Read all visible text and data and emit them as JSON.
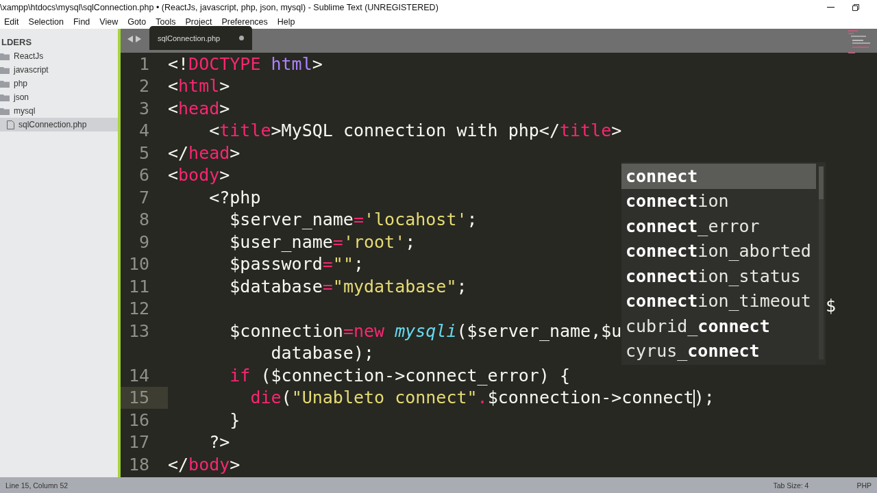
{
  "window": {
    "title": "\\xampp\\htdocs\\mysql\\sqlConnection.php • (ReactJs, javascript, php, json, mysql) - Sublime Text (UNREGISTERED)"
  },
  "menu": [
    "Edit",
    "Selection",
    "Find",
    "View",
    "Goto",
    "Tools",
    "Project",
    "Preferences",
    "Help"
  ],
  "sidebar": {
    "header": "LDERS",
    "items": [
      {
        "label": "ReactJs",
        "kind": "folder",
        "selected": false
      },
      {
        "label": "javascript",
        "kind": "folder",
        "selected": false
      },
      {
        "label": "php",
        "kind": "folder",
        "selected": false
      },
      {
        "label": "json",
        "kind": "folder",
        "selected": false
      },
      {
        "label": "mysql",
        "kind": "folder",
        "selected": false
      },
      {
        "label": "sqlConnection.php",
        "kind": "file",
        "selected": true
      }
    ]
  },
  "tabs": [
    {
      "label": "sqlConnection.php",
      "selected": true,
      "modified": true
    }
  ],
  "editor": {
    "lines": [
      {
        "number": "1",
        "current": false,
        "segments": [
          {
            "kind": "plain",
            "text": "<!"
          },
          {
            "kind": "tag",
            "text": "DOCTYPE"
          },
          {
            "kind": "purple",
            "text": " html"
          },
          {
            "kind": "plain",
            "text": ">"
          }
        ]
      },
      {
        "number": "2",
        "current": false,
        "segments": [
          {
            "kind": "plain",
            "text": "<"
          },
          {
            "kind": "tag",
            "text": "html"
          },
          {
            "kind": "plain",
            "text": ">"
          }
        ]
      },
      {
        "number": "3",
        "current": false,
        "segments": [
          {
            "kind": "plain",
            "text": "<"
          },
          {
            "kind": "tag",
            "text": "head"
          },
          {
            "kind": "plain",
            "text": ">"
          }
        ]
      },
      {
        "number": "4",
        "current": false,
        "segments": [
          {
            "kind": "plain",
            "text": "    <"
          },
          {
            "kind": "tag",
            "text": "title"
          },
          {
            "kind": "plain",
            "text": ">MySQL connection with php</"
          },
          {
            "kind": "tag",
            "text": "title"
          },
          {
            "kind": "plain",
            "text": ">"
          }
        ]
      },
      {
        "number": "5",
        "current": false,
        "segments": [
          {
            "kind": "plain",
            "text": "</"
          },
          {
            "kind": "tag",
            "text": "head"
          },
          {
            "kind": "plain",
            "text": ">"
          }
        ]
      },
      {
        "number": "6",
        "current": false,
        "segments": [
          {
            "kind": "plain",
            "text": "<"
          },
          {
            "kind": "tag",
            "text": "body"
          },
          {
            "kind": "plain",
            "text": ">"
          }
        ]
      },
      {
        "number": "7",
        "current": false,
        "segments": [
          {
            "kind": "plain",
            "text": "    <?php"
          }
        ]
      },
      {
        "number": "8",
        "current": false,
        "segments": [
          {
            "kind": "plain",
            "text": "      $server_name"
          },
          {
            "kind": "tag",
            "text": "="
          },
          {
            "kind": "string",
            "text": "'locahost'"
          },
          {
            "kind": "plain",
            "text": ";"
          }
        ]
      },
      {
        "number": "9",
        "current": false,
        "segments": [
          {
            "kind": "plain",
            "text": "      $user_name"
          },
          {
            "kind": "tag",
            "text": "="
          },
          {
            "kind": "string",
            "text": "'root'"
          },
          {
            "kind": "plain",
            "text": ";"
          }
        ]
      },
      {
        "number": "10",
        "current": false,
        "segments": [
          {
            "kind": "plain",
            "text": "      $password"
          },
          {
            "kind": "tag",
            "text": "="
          },
          {
            "kind": "string",
            "text": "\"\""
          },
          {
            "kind": "plain",
            "text": ";"
          }
        ]
      },
      {
        "number": "11",
        "current": false,
        "segments": [
          {
            "kind": "plain",
            "text": "      $database"
          },
          {
            "kind": "tag",
            "text": "="
          },
          {
            "kind": "string",
            "text": "\"mydatabase\""
          },
          {
            "kind": "plain",
            "text": ";"
          }
        ]
      },
      {
        "number": "12",
        "current": false
      },
      {
        "number": "13",
        "current": false,
        "segments": [
          {
            "kind": "plain",
            "text": "      $connection"
          },
          {
            "kind": "tag",
            "text": "="
          },
          {
            "kind": "tag",
            "text": "new "
          },
          {
            "kind": "class",
            "text": "mysqli"
          },
          {
            "kind": "plain",
            "text": "($server_name,$u"
          }
        ],
        "tail": "$",
        "wrap": "          database);"
      },
      {
        "number": "14",
        "current": false,
        "segments": [
          {
            "kind": "tag",
            "text": "      if"
          },
          {
            "kind": "plain",
            "text": " ($connection->connect_error) {"
          }
        ]
      },
      {
        "number": "15",
        "current": true,
        "segments": [
          {
            "kind": "tag",
            "text": "        die"
          },
          {
            "kind": "plain",
            "text": "("
          },
          {
            "kind": "string",
            "text": "\"Unableto connect\""
          },
          {
            "kind": "tag",
            "text": "."
          },
          {
            "kind": "plain",
            "text": "$connection->connect",
            "cursor_after": true
          },
          {
            "kind": "plain",
            "text": ");"
          }
        ]
      },
      {
        "number": "16",
        "current": false,
        "segments": [
          {
            "kind": "plain",
            "text": "      }"
          }
        ]
      },
      {
        "number": "17",
        "current": false,
        "segments": [
          {
            "kind": "plain",
            "text": "    ?>"
          }
        ]
      },
      {
        "number": "18",
        "current": false,
        "segments": [
          {
            "kind": "plain",
            "text": "</"
          },
          {
            "kind": "tag",
            "text": "body"
          },
          {
            "kind": "plain",
            "text": ">"
          }
        ]
      }
    ]
  },
  "autocomplete": [
    {
      "label": "**connect**",
      "selected": true
    },
    {
      "label": "**connect**ion",
      "selected": false
    },
    {
      "label": "**connect**_error",
      "selected": false
    },
    {
      "label": "**connect**ion_aborted",
      "selected": false
    },
    {
      "label": "**connect**ion_status",
      "selected": false
    },
    {
      "label": "**connect**ion_timeout",
      "selected": false
    },
    {
      "label": "cubrid_**connect**",
      "selected": false
    },
    {
      "label": "cyrus_**connect**",
      "selected": false
    }
  ],
  "status_bar": {
    "position": "Line 15, Column 52",
    "tab_size": "Tab Size: 4",
    "syntax": "PHP"
  }
}
